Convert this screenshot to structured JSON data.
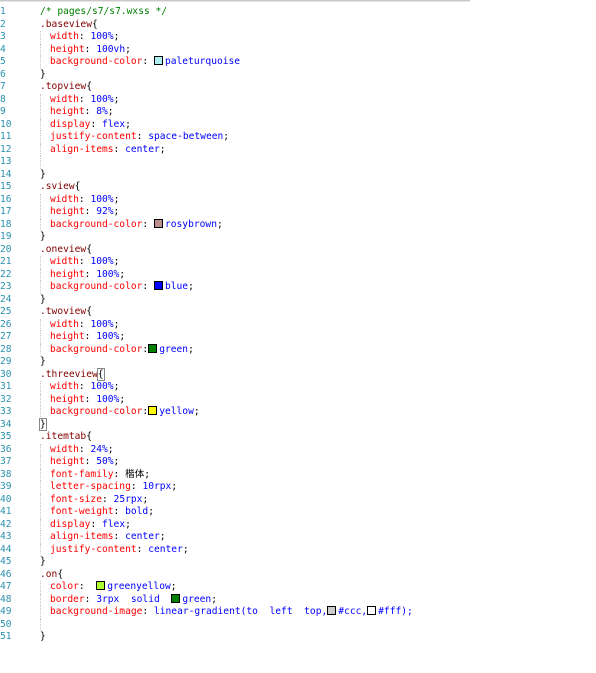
{
  "editor": {
    "lines": [
      {
        "n": "1",
        "parts": [
          {
            "t": "/* pages/s7/s7.wxss */",
            "c": "cmt"
          }
        ]
      },
      {
        "n": "2",
        "parts": [
          {
            "t": ".baseview",
            "c": "sel"
          },
          {
            "t": "{",
            "c": "brace"
          }
        ]
      },
      {
        "n": "3",
        "indent": true,
        "parts": [
          {
            "t": "width",
            "c": "prop"
          },
          {
            "t": ": ",
            "c": "sem"
          },
          {
            "t": "100%",
            "c": "val"
          },
          {
            "t": ";",
            "c": "sem"
          }
        ]
      },
      {
        "n": "4",
        "indent": true,
        "parts": [
          {
            "t": "height",
            "c": "prop"
          },
          {
            "t": ": ",
            "c": "sem"
          },
          {
            "t": "100vh",
            "c": "val"
          },
          {
            "t": ";",
            "c": "sem"
          }
        ]
      },
      {
        "n": "5",
        "indent": true,
        "parts": [
          {
            "t": "background-color",
            "c": "prop"
          },
          {
            "t": ": ",
            "c": "sem"
          },
          {
            "sw": "#afeeee"
          },
          {
            "t": "paleturquoise",
            "c": "val"
          }
        ]
      },
      {
        "n": "6",
        "parts": [
          {
            "t": "}",
            "c": "brace"
          }
        ]
      },
      {
        "n": "7",
        "parts": [
          {
            "t": ".topview",
            "c": "sel"
          },
          {
            "t": "{",
            "c": "brace"
          }
        ]
      },
      {
        "n": "8",
        "indent": true,
        "parts": [
          {
            "t": "width",
            "c": "prop"
          },
          {
            "t": ": ",
            "c": "sem"
          },
          {
            "t": "100%",
            "c": "val"
          },
          {
            "t": ";",
            "c": "sem"
          }
        ]
      },
      {
        "n": "9",
        "indent": true,
        "parts": [
          {
            "t": "height",
            "c": "prop"
          },
          {
            "t": ": ",
            "c": "sem"
          },
          {
            "t": "8%",
            "c": "val"
          },
          {
            "t": ";",
            "c": "sem"
          }
        ]
      },
      {
        "n": "10",
        "indent": true,
        "parts": [
          {
            "t": "display",
            "c": "prop"
          },
          {
            "t": ": ",
            "c": "sem"
          },
          {
            "t": "flex",
            "c": "val"
          },
          {
            "t": ";",
            "c": "sem"
          }
        ]
      },
      {
        "n": "11",
        "indent": true,
        "parts": [
          {
            "t": "justify-content",
            "c": "prop"
          },
          {
            "t": ": ",
            "c": "sem"
          },
          {
            "t": "space-between",
            "c": "val"
          },
          {
            "t": ";",
            "c": "sem"
          }
        ]
      },
      {
        "n": "12",
        "indent": true,
        "parts": [
          {
            "t": "align-items",
            "c": "prop"
          },
          {
            "t": ": ",
            "c": "sem"
          },
          {
            "t": "center",
            "c": "val"
          },
          {
            "t": ";",
            "c": "sem"
          }
        ]
      },
      {
        "n": "13",
        "indent": true,
        "parts": []
      },
      {
        "n": "14",
        "parts": [
          {
            "t": "}",
            "c": "brace"
          }
        ]
      },
      {
        "n": "15",
        "parts": [
          {
            "t": ".sview",
            "c": "sel"
          },
          {
            "t": "{",
            "c": "brace"
          }
        ]
      },
      {
        "n": "16",
        "indent": true,
        "parts": [
          {
            "t": "width",
            "c": "prop"
          },
          {
            "t": ": ",
            "c": "sem"
          },
          {
            "t": "100%",
            "c": "val"
          },
          {
            "t": ";",
            "c": "sem"
          }
        ]
      },
      {
        "n": "17",
        "indent": true,
        "parts": [
          {
            "t": "height",
            "c": "prop"
          },
          {
            "t": ": ",
            "c": "sem"
          },
          {
            "t": "92%",
            "c": "val"
          },
          {
            "t": ";",
            "c": "sem"
          }
        ]
      },
      {
        "n": "18",
        "indent": true,
        "parts": [
          {
            "t": "background-color",
            "c": "prop"
          },
          {
            "t": ": ",
            "c": "sem"
          },
          {
            "sw": "#bc8f8f"
          },
          {
            "t": "rosybrown",
            "c": "val"
          },
          {
            "t": ";",
            "c": "sem"
          }
        ]
      },
      {
        "n": "19",
        "parts": [
          {
            "t": "}",
            "c": "brace"
          }
        ]
      },
      {
        "n": "20",
        "parts": [
          {
            "t": ".oneview",
            "c": "sel"
          },
          {
            "t": "{",
            "c": "brace"
          }
        ]
      },
      {
        "n": "21",
        "indent": true,
        "parts": [
          {
            "t": "width",
            "c": "prop"
          },
          {
            "t": ": ",
            "c": "sem"
          },
          {
            "t": "100%",
            "c": "val"
          },
          {
            "t": ";",
            "c": "sem"
          }
        ]
      },
      {
        "n": "22",
        "indent": true,
        "parts": [
          {
            "t": "height",
            "c": "prop"
          },
          {
            "t": ": ",
            "c": "sem"
          },
          {
            "t": "100%",
            "c": "val"
          },
          {
            "t": ";",
            "c": "sem"
          }
        ]
      },
      {
        "n": "23",
        "indent": true,
        "parts": [
          {
            "t": "background-color",
            "c": "prop"
          },
          {
            "t": ": ",
            "c": "sem"
          },
          {
            "sw": "#0000ff"
          },
          {
            "t": "blue",
            "c": "val"
          },
          {
            "t": ";",
            "c": "sem"
          }
        ]
      },
      {
        "n": "24",
        "parts": [
          {
            "t": "}",
            "c": "brace"
          }
        ]
      },
      {
        "n": "25",
        "parts": [
          {
            "t": ".twoview",
            "c": "sel"
          },
          {
            "t": "{",
            "c": "brace"
          }
        ]
      },
      {
        "n": "26",
        "indent": true,
        "parts": [
          {
            "t": "width",
            "c": "prop"
          },
          {
            "t": ": ",
            "c": "sem"
          },
          {
            "t": "100%",
            "c": "val"
          },
          {
            "t": ";",
            "c": "sem"
          }
        ]
      },
      {
        "n": "27",
        "indent": true,
        "parts": [
          {
            "t": "height",
            "c": "prop"
          },
          {
            "t": ": ",
            "c": "sem"
          },
          {
            "t": "100%",
            "c": "val"
          },
          {
            "t": ";",
            "c": "sem"
          }
        ]
      },
      {
        "n": "28",
        "indent": true,
        "parts": [
          {
            "t": "background-color",
            "c": "prop"
          },
          {
            "t": ":",
            "c": "sem"
          },
          {
            "sw": "#008000"
          },
          {
            "t": "green",
            "c": "val"
          },
          {
            "t": ";",
            "c": "sem"
          }
        ]
      },
      {
        "n": "29",
        "parts": [
          {
            "t": "}",
            "c": "brace"
          }
        ]
      },
      {
        "n": "30",
        "parts": [
          {
            "t": ".threeview",
            "c": "sel"
          },
          {
            "t": "{",
            "c": "brace",
            "cur": true
          }
        ]
      },
      {
        "n": "31",
        "indent": true,
        "parts": [
          {
            "t": "width",
            "c": "prop"
          },
          {
            "t": ": ",
            "c": "sem"
          },
          {
            "t": "100%",
            "c": "val"
          },
          {
            "t": ";",
            "c": "sem"
          }
        ]
      },
      {
        "n": "32",
        "indent": true,
        "parts": [
          {
            "t": "height",
            "c": "prop"
          },
          {
            "t": ": ",
            "c": "sem"
          },
          {
            "t": "100%",
            "c": "val"
          },
          {
            "t": ";",
            "c": "sem"
          }
        ]
      },
      {
        "n": "33",
        "indent": true,
        "parts": [
          {
            "t": "background-color",
            "c": "prop"
          },
          {
            "t": ":",
            "c": "sem"
          },
          {
            "sw": "#ffff00"
          },
          {
            "t": "yellow",
            "c": "val"
          },
          {
            "t": ";",
            "c": "sem"
          }
        ]
      },
      {
        "n": "34",
        "parts": [
          {
            "t": "}",
            "c": "brace",
            "cur": true
          }
        ]
      },
      {
        "n": "35",
        "parts": [
          {
            "t": ".itemtab",
            "c": "sel"
          },
          {
            "t": "{",
            "c": "brace"
          }
        ]
      },
      {
        "n": "36",
        "indent": true,
        "parts": [
          {
            "t": "width",
            "c": "prop"
          },
          {
            "t": ": ",
            "c": "sem"
          },
          {
            "t": "24%",
            "c": "val"
          },
          {
            "t": ";",
            "c": "sem"
          }
        ]
      },
      {
        "n": "37",
        "indent": true,
        "parts": [
          {
            "t": "height",
            "c": "prop"
          },
          {
            "t": ": ",
            "c": "sem"
          },
          {
            "t": "50%",
            "c": "val"
          },
          {
            "t": ";",
            "c": "sem"
          }
        ]
      },
      {
        "n": "38",
        "indent": true,
        "parts": [
          {
            "t": "font-family",
            "c": "prop"
          },
          {
            "t": ": ",
            "c": "sem"
          },
          {
            "t": "楷体",
            "c": "cjk"
          },
          {
            "t": ";",
            "c": "sem"
          }
        ]
      },
      {
        "n": "39",
        "indent": true,
        "parts": [
          {
            "t": "letter-spacing",
            "c": "prop"
          },
          {
            "t": ": ",
            "c": "sem"
          },
          {
            "t": "10rpx",
            "c": "val"
          },
          {
            "t": ";",
            "c": "sem"
          }
        ]
      },
      {
        "n": "40",
        "indent": true,
        "parts": [
          {
            "t": "font-size",
            "c": "prop"
          },
          {
            "t": ": ",
            "c": "sem"
          },
          {
            "t": "25rpx",
            "c": "val"
          },
          {
            "t": ";",
            "c": "sem"
          }
        ]
      },
      {
        "n": "41",
        "indent": true,
        "parts": [
          {
            "t": "font-weight",
            "c": "prop"
          },
          {
            "t": ": ",
            "c": "sem"
          },
          {
            "t": "bold",
            "c": "val"
          },
          {
            "t": ";",
            "c": "sem"
          }
        ]
      },
      {
        "n": "42",
        "indent": true,
        "parts": [
          {
            "t": "display",
            "c": "prop"
          },
          {
            "t": ": ",
            "c": "sem"
          },
          {
            "t": "flex",
            "c": "val"
          },
          {
            "t": ";",
            "c": "sem"
          }
        ]
      },
      {
        "n": "43",
        "indent": true,
        "parts": [
          {
            "t": "align-items",
            "c": "prop"
          },
          {
            "t": ": ",
            "c": "sem"
          },
          {
            "t": "center",
            "c": "val"
          },
          {
            "t": ";",
            "c": "sem"
          }
        ]
      },
      {
        "n": "44",
        "indent": true,
        "parts": [
          {
            "t": "justify-content",
            "c": "prop"
          },
          {
            "t": ": ",
            "c": "sem"
          },
          {
            "t": "center",
            "c": "val"
          },
          {
            "t": ";",
            "c": "sem"
          }
        ]
      },
      {
        "n": "45",
        "parts": [
          {
            "t": "}",
            "c": "brace"
          }
        ]
      },
      {
        "n": "46",
        "parts": [
          {
            "t": ".on",
            "c": "sel"
          },
          {
            "t": "{",
            "c": "brace"
          }
        ]
      },
      {
        "n": "47",
        "indent": true,
        "parts": [
          {
            "t": "color",
            "c": "prop"
          },
          {
            "t": ":  ",
            "c": "sem"
          },
          {
            "sw": "#adff2f"
          },
          {
            "t": "greenyellow",
            "c": "val"
          },
          {
            "t": ";",
            "c": "sem"
          }
        ]
      },
      {
        "n": "48",
        "indent": true,
        "parts": [
          {
            "t": "border",
            "c": "prop"
          },
          {
            "t": ": ",
            "c": "sem"
          },
          {
            "t": "3rpx  solid  ",
            "c": "val"
          },
          {
            "sw": "#008000"
          },
          {
            "t": "green",
            "c": "val"
          },
          {
            "t": ";",
            "c": "sem"
          }
        ]
      },
      {
        "n": "49",
        "indent": true,
        "parts": [
          {
            "t": "background-image",
            "c": "prop"
          },
          {
            "t": ": ",
            "c": "sem"
          },
          {
            "t": "linear-gradient(to  left  top,",
            "c": "val"
          },
          {
            "sw": "#cccccc"
          },
          {
            "t": "#ccc,",
            "c": "val"
          },
          {
            "sw": "#ffffff"
          },
          {
            "t": "#fff);",
            "c": "val"
          }
        ]
      },
      {
        "n": "50",
        "indent": true,
        "parts": []
      },
      {
        "n": "51",
        "parts": [
          {
            "t": "}",
            "c": "brace"
          }
        ]
      }
    ]
  }
}
